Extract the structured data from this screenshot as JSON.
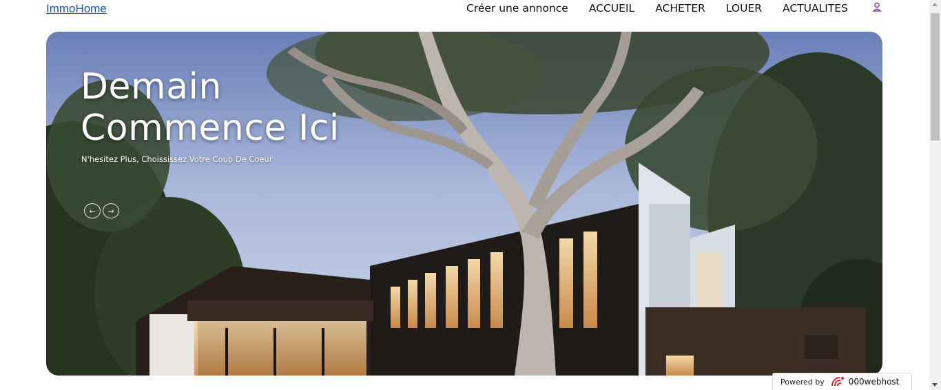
{
  "header": {
    "brand": "ImmoHome",
    "nav": [
      {
        "label": "Créer une annonce"
      },
      {
        "label": "ACCUEIL"
      },
      {
        "label": "ACHETER"
      },
      {
        "label": "LOUER"
      },
      {
        "label": "ACTUALITES"
      }
    ],
    "user_icon": "user-icon"
  },
  "hero": {
    "title_line1": "Demain",
    "title_line2": "Commence Ici",
    "subtitle": "N'hesitez Plus, Choississez Votre Coup De Coeur",
    "prev_arrow": "←",
    "next_arrow": "→",
    "image": "modern house with large tree at dusk"
  },
  "badge": {
    "label": "Powered by",
    "brand": "000webhost",
    "logo_icon": "000webhost-logo-icon"
  },
  "colors": {
    "brand_link": "#0b57d0",
    "user_icon": "#7b3fc4"
  }
}
